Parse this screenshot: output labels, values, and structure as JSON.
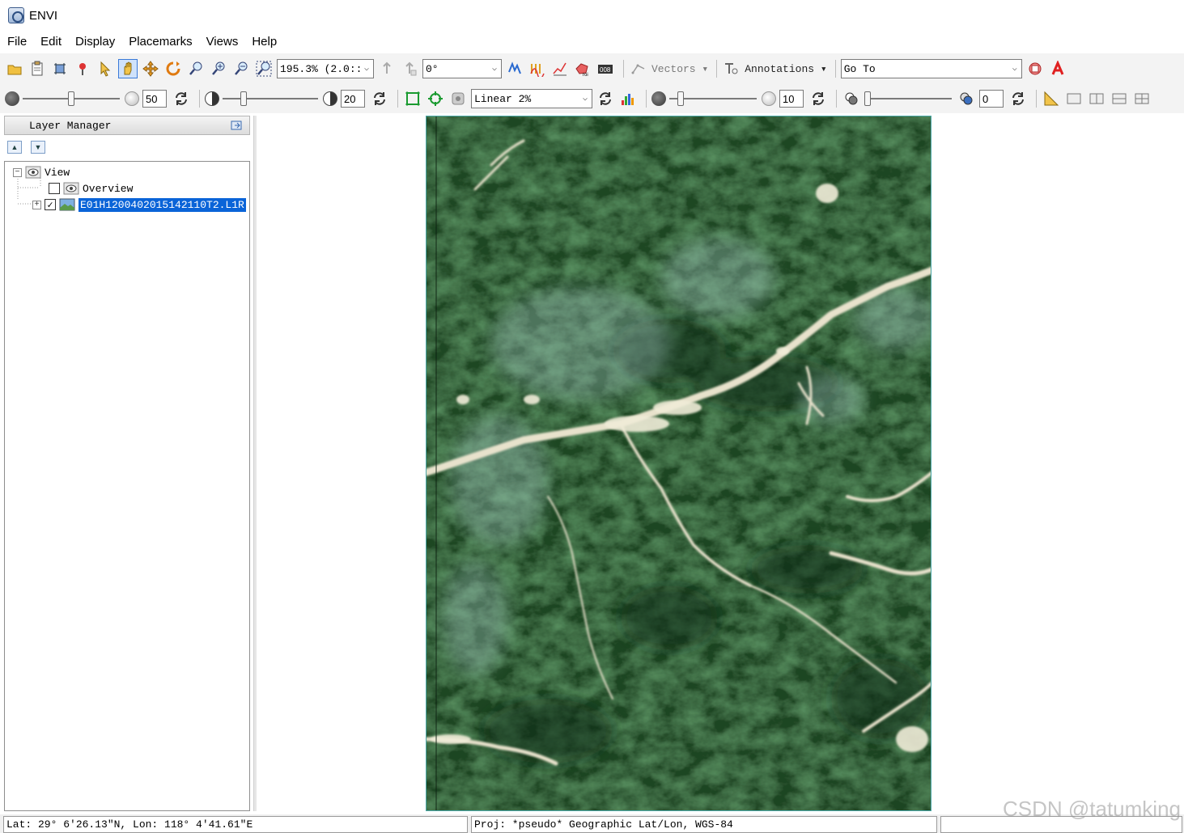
{
  "window": {
    "title": "ENVI"
  },
  "menu": [
    "File",
    "Edit",
    "Display",
    "Placemarks",
    "Views",
    "Help"
  ],
  "toolbar1": {
    "zoom_value": "195.3% (2.0::",
    "rotation_value": "0°",
    "vectors_label": "Vectors",
    "annotations_label": "Annotations",
    "goto_value": "Go To"
  },
  "toolbar2": {
    "brightness_value": "50",
    "contrast_value": "20",
    "stretch_value": "Linear 2%",
    "sharpen_value": "10",
    "transparency_value": "0",
    "brightness_level": 0.5,
    "contrast_level": 0.2,
    "sharpen_level": 0.1,
    "transparency_level": 0.0
  },
  "layer_manager": {
    "title": "Layer Manager",
    "tree": {
      "view_label": "View",
      "overview_label": "Overview",
      "layer_label": "E01H1200402015142110T2.L1R"
    }
  },
  "status": {
    "coords": "Lat: 29° 6′26.13″N, Lon: 118° 4′41.61″E",
    "projection": "Proj: *pseudo* Geographic Lat/Lon, WGS-84"
  },
  "watermark": "CSDN @tatumking",
  "colors": {
    "selection": "#0a64d8",
    "forest": "#2f6b2f"
  }
}
